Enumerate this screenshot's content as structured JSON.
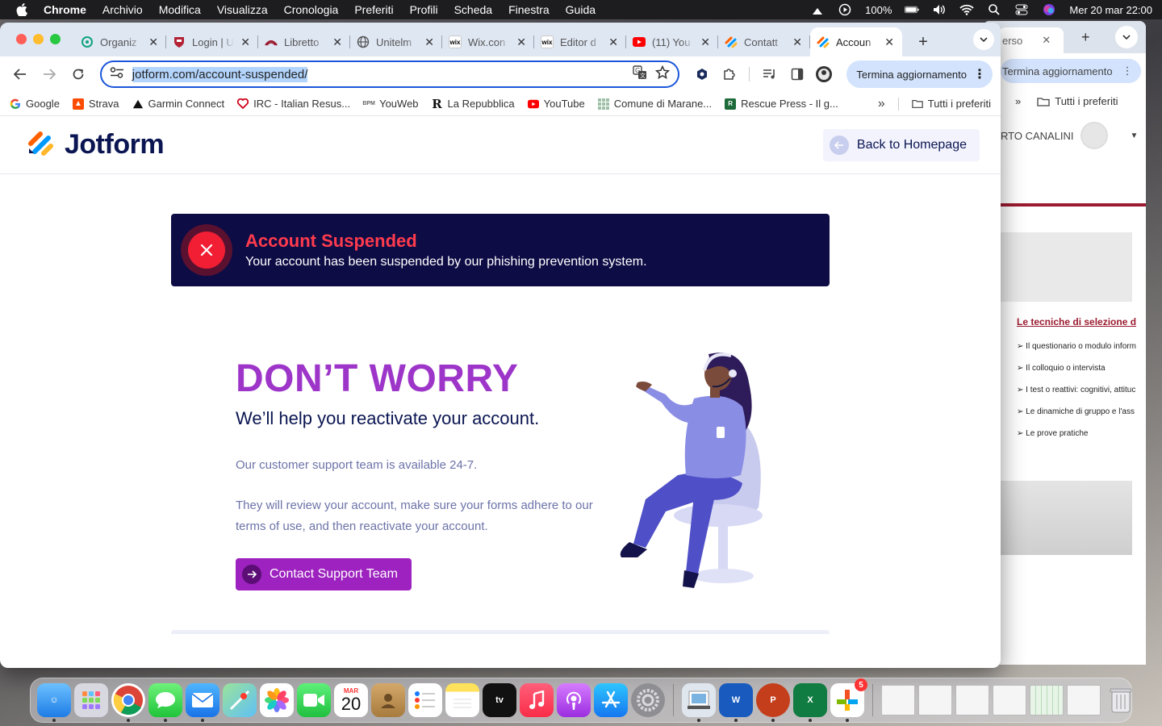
{
  "menubar": {
    "items": [
      "Chrome",
      "Archivio",
      "Modifica",
      "Visualizza",
      "Cronologia",
      "Preferiti",
      "Profili",
      "Scheda",
      "Finestra",
      "Guida"
    ],
    "battery": "100%",
    "datetime": "Mer 20 mar  22:00"
  },
  "browser": {
    "tabs": [
      {
        "label": "Organiz",
        "favicon": "openai-icon",
        "color": "#10a37f"
      },
      {
        "label": "Login | U",
        "favicon": "shield-crest-icon",
        "color": "#b22234"
      },
      {
        "label": "Libretto",
        "favicon": "university-logo-icon",
        "color": "#9b1b30"
      },
      {
        "label": "Unitelm",
        "favicon": "globe-icon",
        "color": "#555555"
      },
      {
        "label": "Wix.con",
        "favicon": "wix-icon",
        "color": "#000000"
      },
      {
        "label": "Editor d",
        "favicon": "wix-icon",
        "color": "#000000"
      },
      {
        "label": "(11) You",
        "favicon": "youtube-icon",
        "color": "#ff0000"
      },
      {
        "label": "Contatt",
        "favicon": "jotform-icon",
        "color": "#ff6100"
      },
      {
        "label": "Accoun",
        "favicon": "jotform-icon",
        "color": "#ff6100",
        "active": true
      }
    ],
    "url_host": "jotform.com",
    "url_path": "/account-suspended/",
    "update_button": "Termina aggiornamento",
    "bookmarks": [
      {
        "label": "Google",
        "icon": "google-icon"
      },
      {
        "label": "Strava",
        "icon": "strava-icon"
      },
      {
        "label": "Garmin Connect",
        "icon": "garmin-icon"
      },
      {
        "label": "IRC - Italian Resus...",
        "icon": "heart-icon"
      },
      {
        "label": "YouWeb",
        "icon": "bank-icon"
      },
      {
        "label": "La Repubblica",
        "icon": "repubblica-icon"
      },
      {
        "label": "YouTube",
        "icon": "youtube-icon"
      },
      {
        "label": "Comune di Marane...",
        "icon": "comune-icon"
      },
      {
        "label": "Rescue Press - Il g...",
        "icon": "rescue-icon"
      }
    ],
    "all_bookmarks": "Tutti i preferiti"
  },
  "page": {
    "logo_text": "Jotform",
    "back_button": "Back to Homepage",
    "alert": {
      "title": "Account Suspended",
      "text": "Your account has been suspended by our phishing prevention system."
    },
    "heading": "DON’T WORRY",
    "subheading": "We’ll help you reactivate your account.",
    "paragraph1": "Our customer support team is available 24-7.",
    "paragraph2": "They will review your account, make sure your forms adhere to our terms of use, and then reactivate your account.",
    "cta": "Contact Support Team"
  },
  "background_window": {
    "tab_label": "erso",
    "update_button": "Termina aggiornamento",
    "all_bookmarks": "Tutti i preferiti",
    "user_name": "RTO CANALINI",
    "section_title": "Le tecniche di selezione d",
    "list": [
      "Il questionario o modulo inform",
      "Il colloquio o intervista",
      "I test o reattivi: cognitivi, attituc",
      "Le dinamiche di gruppo e l'ass",
      "Le prove pratiche"
    ]
  },
  "dock": {
    "calendar_month": "MAR",
    "calendar_day": "20",
    "badge_count": "5",
    "apps": [
      "Finder",
      "Launchpad",
      "Chrome",
      "Messaggi",
      "Mail",
      "Mappe",
      "Foto",
      "FaceTime",
      "Calendario",
      "Contatti",
      "Promemoria",
      "Note",
      "Apple TV",
      "Musica",
      "Podcast",
      "App Store",
      "Impostazioni",
      "Anteprima",
      "Word",
      "PowerPoint",
      "Excel",
      "Microsoft 365"
    ]
  }
}
